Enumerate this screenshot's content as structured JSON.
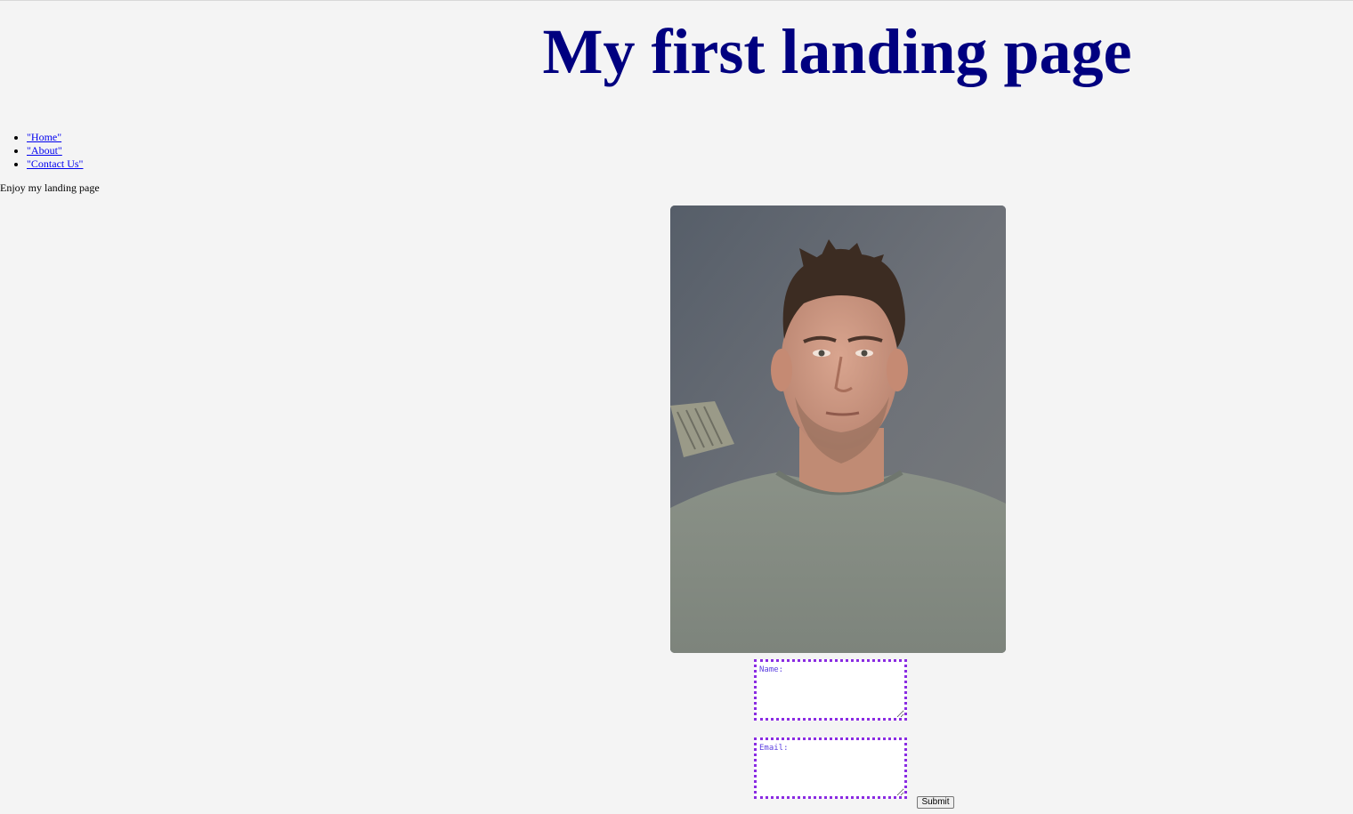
{
  "header": {
    "title": "My first landing page"
  },
  "nav": {
    "items": [
      {
        "label": "\"Home\""
      },
      {
        "label": "\"About\""
      },
      {
        "label": "\"Contact Us\""
      }
    ]
  },
  "intro": {
    "tagline": "Enjoy my landing page"
  },
  "form": {
    "name_placeholder": "Name:",
    "email_placeholder": "Email:",
    "submit_label": "Submit"
  },
  "colors": {
    "title": "#000080",
    "link": "#0000ee",
    "field_border": "#8a2be2",
    "background": "#f4f4f4"
  }
}
